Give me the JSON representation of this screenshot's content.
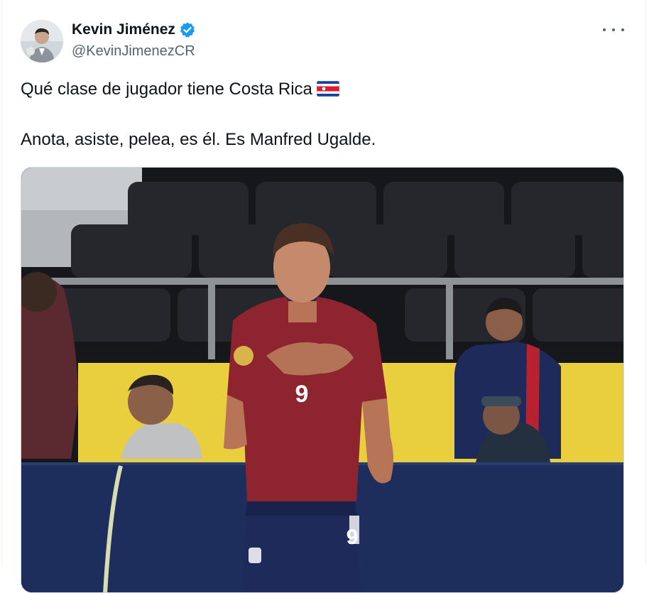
{
  "author": {
    "display_name": "Kevin Jiménez",
    "handle": "@KevinJimenezCR",
    "verified": true,
    "avatar_icon": "profile-photo"
  },
  "menu": {
    "icon": "more-options-icon"
  },
  "tweet": {
    "line1": "Qué clase de jugador tiene Costa Rica",
    "line1_emoji": "costa-rica-flag",
    "line2": "Anota, asiste, pelea, es él. Es Manfred Ugalde."
  },
  "media": {
    "kind": "photo",
    "jersey_number": "9",
    "colors": {
      "jersey": "#8e2430",
      "shorts": "#1e2a5a",
      "stadium_seats": "#202226",
      "ad_board": "#e9cf3e",
      "pitch_wall": "#1d2d5c"
    }
  },
  "colors": {
    "text_primary": "#0f1419",
    "text_secondary": "#536471",
    "verified_blue": "#1d9bf0",
    "border": "#cfd9de"
  }
}
